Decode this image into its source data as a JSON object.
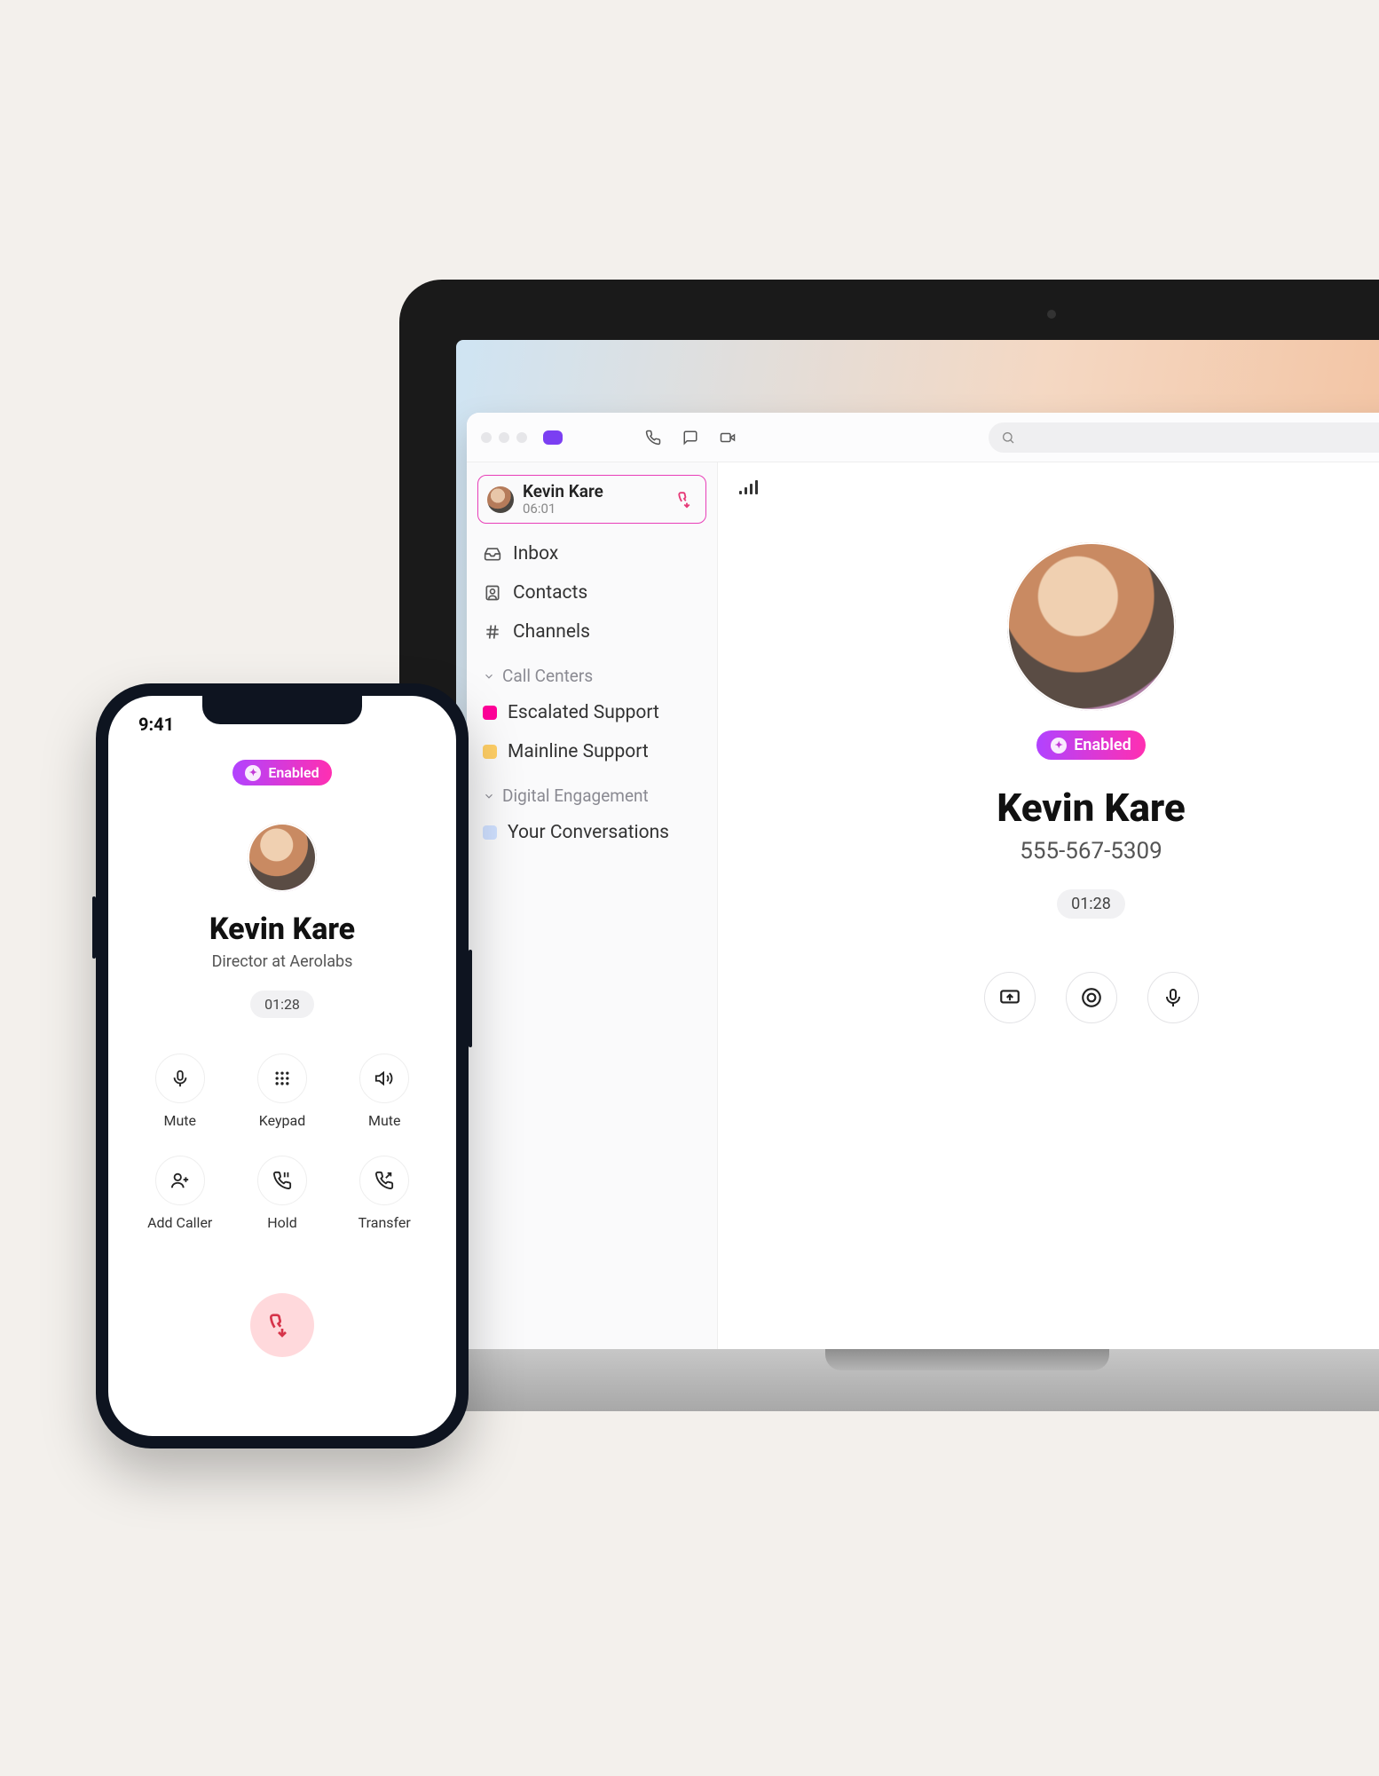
{
  "phone": {
    "status_time": "9:41",
    "enabled_label": "Enabled",
    "caller_name": "Kevin Kare",
    "caller_role": "Director at Aerolabs",
    "call_timer": "01:28",
    "buttons": {
      "mute": "Mute",
      "keypad": "Keypad",
      "speaker": "Mute",
      "add_caller": "Add Caller",
      "hold": "Hold",
      "transfer": "Transfer"
    }
  },
  "desktop": {
    "active_call": {
      "name": "Kevin Kare",
      "duration": "06:01"
    },
    "nav": {
      "inbox": "Inbox",
      "contacts": "Contacts",
      "channels": "Channels"
    },
    "sections": {
      "call_centers": {
        "title": "Call Centers",
        "items": {
          "escalated": "Escalated Support",
          "mainline": "Mainline Support"
        }
      },
      "digital": {
        "title": "Digital Engagement",
        "items": {
          "yours": "Your Conversations"
        }
      }
    },
    "main": {
      "enabled_label": "Enabled",
      "name": "Kevin Kare",
      "phone_number": "555-567-5309",
      "timer": "01:28"
    }
  }
}
